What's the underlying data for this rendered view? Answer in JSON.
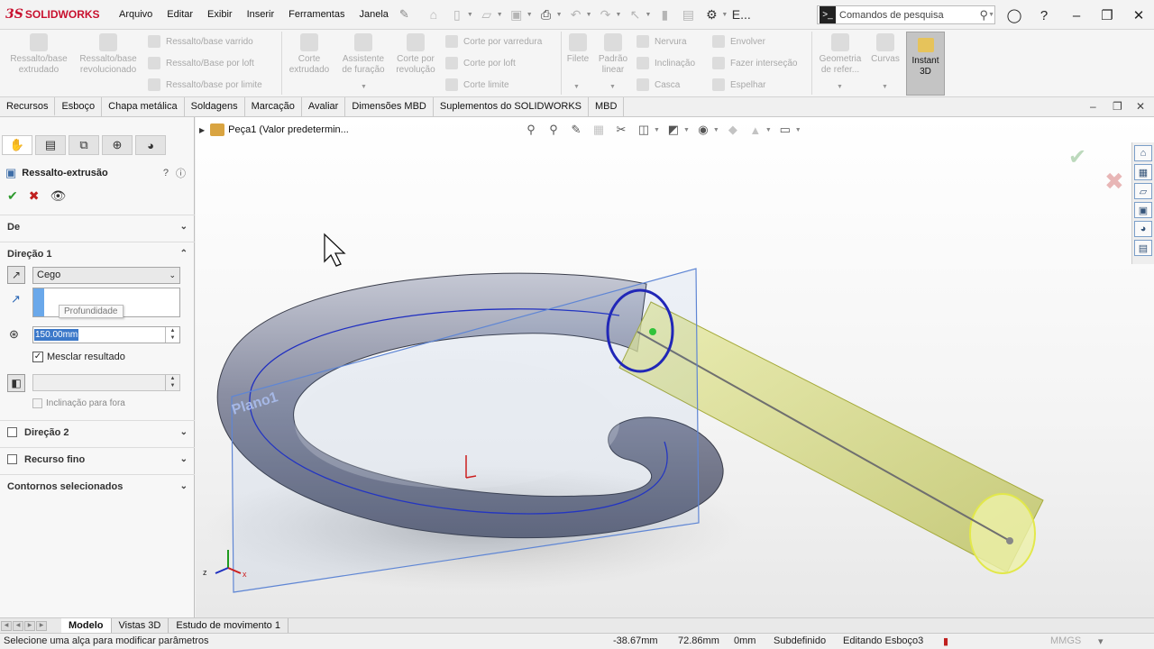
{
  "app": {
    "brand": "SOLIDWORKS",
    "brand_prefix": "3S"
  },
  "menu": [
    "Arquivo",
    "Editar",
    "Exibir",
    "Inserir",
    "Ferramentas",
    "Janela"
  ],
  "menu_more": "E...",
  "search": {
    "placeholder": "Comandos de pesquisa"
  },
  "ribbon": {
    "extrude_boss": "Ressalto/base extrudado",
    "revolve_boss": "Ressalto/base revolucionado",
    "swept_boss": "Ressalto/base varrido",
    "loft_boss": "Ressalto/Base por loft",
    "boundary_boss": "Ressalto/base por limite",
    "extruded_cut": "Corte extrudado",
    "hole_wizard": "Assistente de furação",
    "revolved_cut": "Corte por revolução",
    "swept_cut": "Corte por varredura",
    "lofted_cut": "Corte por loft",
    "boundary_cut": "Corte limite",
    "fillet": "Filete",
    "linear_pattern": "Padrão linear",
    "rib": "Nervura",
    "draft": "Inclinação",
    "shell": "Casca",
    "wrap": "Envolver",
    "intersect": "Fazer interseção",
    "mirror": "Espelhar",
    "ref_geometry": "Geometria de refer...",
    "curves": "Curvas",
    "instant3d": "Instant 3D"
  },
  "cm_tabs": [
    "Recursos",
    "Esboço",
    "Chapa metálica",
    "Soldagens",
    "Marcação",
    "Avaliar",
    "Dimensões MBD",
    "Suplementos do SOLIDWORKS",
    "MBD"
  ],
  "pm": {
    "title": "Ressalto-extrusão",
    "section_from": "De",
    "section_dir1": "Direção 1",
    "end_condition": "Cego",
    "depth_tooltip": "Profundidade",
    "depth_value": "150.00mm",
    "merge_result": "Mesclar resultado",
    "draft_outward": "Inclinação para fora",
    "section_dir2": "Direção 2",
    "section_thin": "Recurso fino",
    "section_contours": "Contornos selecionados"
  },
  "viewport": {
    "tree_root": "Peça1 (Valor predetermin...",
    "plane_label": "Plano1",
    "accent_plane": "#5f86d4",
    "accent_extrude": "#d9de6a",
    "torus_color": "#7e8296"
  },
  "bottom_tabs": [
    "Modelo",
    "Vistas 3D",
    "Estudo de movimento 1"
  ],
  "status": {
    "message": "Selecione uma alça para modificar parâmetros",
    "x": "-38.67mm",
    "y": "72.86mm",
    "z": "0mm",
    "definition": "Subdefinido",
    "editing": "Editando Esboço3",
    "units": "MMGS"
  }
}
